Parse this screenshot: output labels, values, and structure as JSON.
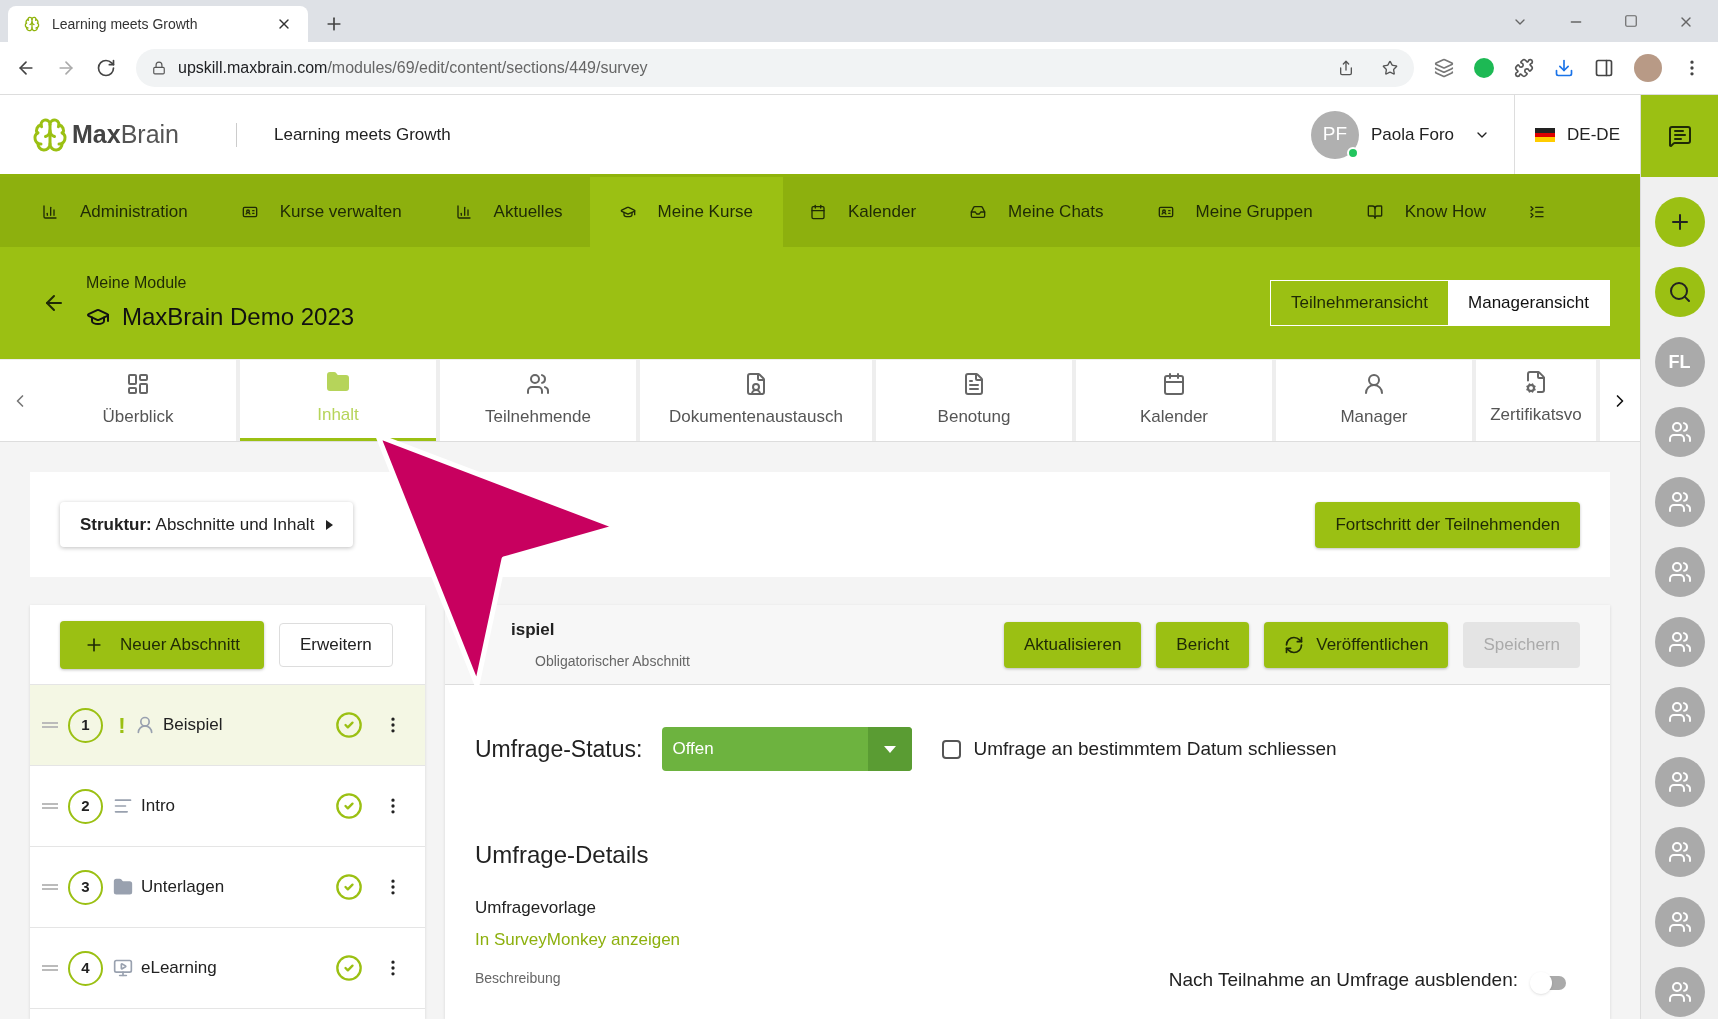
{
  "browser": {
    "tab_title": "Learning meets Growth",
    "url_host": "upskill.maxbrain.com",
    "url_path": "/modules/69/edit/content/sections/449/survey"
  },
  "header": {
    "logo_bold": "Max",
    "logo_light": "Brain",
    "tagline": "Learning meets Growth",
    "user_initials": "PF",
    "user_online": true,
    "user_name": "Paola Foro",
    "language": "DE-DE"
  },
  "nav": [
    {
      "label": "Administration",
      "kind": "stats",
      "selected": false
    },
    {
      "label": "Kurse verwalten",
      "kind": "card",
      "selected": false
    },
    {
      "label": "Aktuelles",
      "kind": "stats",
      "selected": false
    },
    {
      "label": "Meine Kurse",
      "kind": "cap",
      "selected": true
    },
    {
      "label": "Kalender",
      "kind": "calendar",
      "selected": false
    },
    {
      "label": "Meine Chats",
      "kind": "inbox",
      "selected": false
    },
    {
      "label": "Meine Gruppen",
      "kind": "card",
      "selected": false
    },
    {
      "label": "Know How",
      "kind": "book",
      "selected": false
    }
  ],
  "module": {
    "breadcrumb": "Meine Module",
    "title": "MaxBrain Demo 2023",
    "views": [
      {
        "label": "Teilnehmeransicht",
        "selected": false
      },
      {
        "label": "Manageransicht",
        "selected": true
      }
    ]
  },
  "tabs": [
    {
      "label": "Überblick",
      "kind": "dashboard",
      "selected": false
    },
    {
      "label": "Inhalt",
      "kind": "folder",
      "selected": true
    },
    {
      "label": "Teilnehmende",
      "kind": "users",
      "selected": false
    },
    {
      "label": "Dokumentenaustausch",
      "kind": "userfile",
      "selected": false
    },
    {
      "label": "Benotung",
      "kind": "grade",
      "selected": false
    },
    {
      "label": "Kalender",
      "kind": "calendar",
      "selected": false
    },
    {
      "label": "Manager",
      "kind": "manager",
      "selected": false
    },
    {
      "label": "Zertifikatsvo",
      "kind": "cert",
      "selected": false
    }
  ],
  "structure": {
    "label_bold": "Struktur:",
    "label": "Abschnitte und Inhalt",
    "progress_button": "Fortschritt der Teilnehmenden"
  },
  "sections": {
    "new_button": "Neuer Abschnitt",
    "expand_button": "Erweitern",
    "items": [
      {
        "number": "1",
        "flag": "!",
        "title": "Beispiel",
        "kind": "survey",
        "done": true,
        "selected": true
      },
      {
        "number": "2",
        "title": "Intro",
        "kind": "text",
        "done": true,
        "selected": false
      },
      {
        "number": "3",
        "title": "Unterlagen",
        "kind": "folder",
        "done": true,
        "selected": false
      },
      {
        "number": "4",
        "title": "eLearning",
        "kind": "elearning",
        "done": true,
        "selected": false
      }
    ]
  },
  "detail": {
    "title": "ispiel",
    "subtitle": "Obligatorischer Abschnitt",
    "buttons": [
      {
        "label": "Aktualisieren",
        "kind": "plain",
        "disabled": false
      },
      {
        "label": "Bericht",
        "kind": "plain",
        "disabled": false
      },
      {
        "label": "Veröffentlichen",
        "kind": "sync",
        "disabled": false
      },
      {
        "label": "Speichern",
        "kind": "plain",
        "disabled": true
      }
    ],
    "status_label": "Umfrage-Status:",
    "status_value": "Offen",
    "close_on_date": {
      "label": "Umfrage an bestimmtem Datum schliessen",
      "checked": false
    },
    "details_heading": "Umfrage-Details",
    "template_label": "Umfragevorlage",
    "template_link": "In SurveyMonkey anzeigen",
    "description_label": "Beschreibung",
    "hide_after": {
      "label": "Nach Teilnahme an Umfrage ausblenden:",
      "on": false
    }
  },
  "sidebar": {
    "avatar_initials": "FL",
    "avatars": [
      {
        "kind": "group"
      },
      {
        "kind": "group"
      },
      {
        "kind": "group"
      },
      {
        "kind": "group"
      },
      {
        "kind": "group"
      },
      {
        "kind": "group"
      },
      {
        "kind": "group"
      },
      {
        "kind": "group"
      },
      {
        "kind": "group"
      }
    ]
  }
}
